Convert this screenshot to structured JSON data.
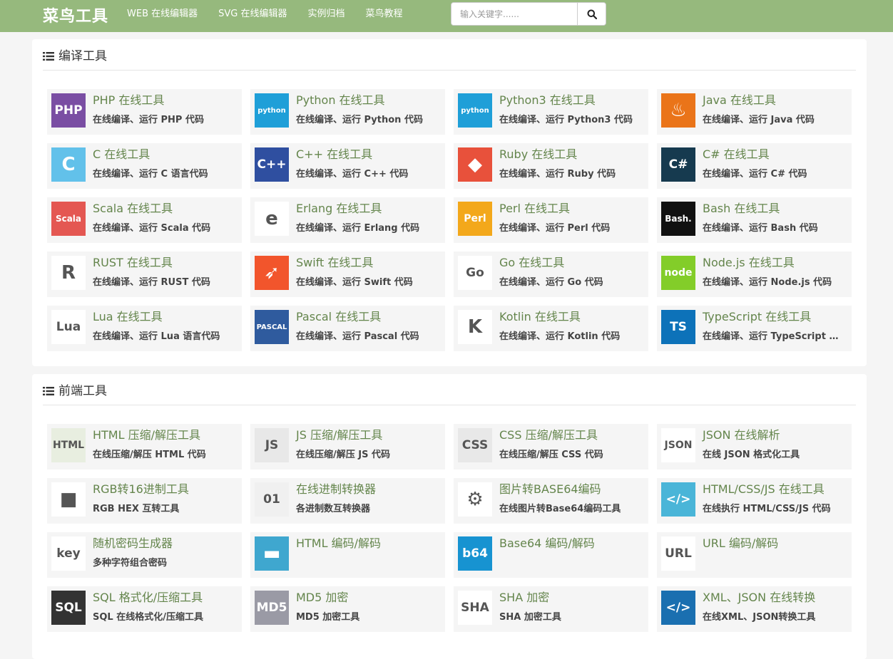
{
  "nav": {
    "brand": "菜鸟工具",
    "links": [
      "WEB 在线编辑器",
      "SVG 在线编辑器",
      "实例归档",
      "菜鸟教程"
    ],
    "search_placeholder": "输入关键字......"
  },
  "sections": [
    {
      "title": "编译工具",
      "items": [
        {
          "title": "PHP 在线工具",
          "desc": "在线编译、运行 PHP 代码",
          "icon": "php-icon",
          "bg": "#7a4ea3",
          "label": "PHP"
        },
        {
          "title": "Python 在线工具",
          "desc": "在线编译、运行 Python 代码",
          "icon": "python-icon",
          "bg": "#1f9fd8",
          "label": "python"
        },
        {
          "title": "Python3 在线工具",
          "desc": "在线编译、运行 Python3 代码",
          "icon": "python3-icon",
          "bg": "#1f9fd8",
          "label": "python"
        },
        {
          "title": "Java 在线工具",
          "desc": "在线编译、运行 Java 代码",
          "icon": "java-icon",
          "bg": "#ea7419",
          "label": "♨"
        },
        {
          "title": "C 在线工具",
          "desc": "在线编译、运行 C 语言代码",
          "icon": "c-icon",
          "bg": "#62c1ea",
          "label": "C"
        },
        {
          "title": "C++ 在线工具",
          "desc": "在线编译、运行 C++ 代码",
          "icon": "cpp-icon",
          "bg": "#2f4fa0",
          "label": "C++"
        },
        {
          "title": "Ruby 在线工具",
          "desc": "在线编译、运行 Ruby 代码",
          "icon": "ruby-icon",
          "bg": "#e8513b",
          "label": "◆"
        },
        {
          "title": "C# 在线工具",
          "desc": "在线编译、运行 C# 代码",
          "icon": "csharp-icon",
          "bg": "#163a4f",
          "label": "C#"
        },
        {
          "title": "Scala 在线工具",
          "desc": "在线编译、运行 Scala 代码",
          "icon": "scala-icon",
          "bg": "#e45752",
          "label": "Scala"
        },
        {
          "title": "Erlang 在线工具",
          "desc": "在线编译、运行 Erlang 代码",
          "icon": "erlang-icon",
          "bg": "#ffffff",
          "label": "e"
        },
        {
          "title": "Perl 在线工具",
          "desc": "在线编译、运行 Perl 代码",
          "icon": "perl-icon",
          "bg": "#f3a81b",
          "label": "Perl"
        },
        {
          "title": "Bash 在线工具",
          "desc": "在线编译、运行 Bash 代码",
          "icon": "bash-icon",
          "bg": "#111111",
          "label": "Bash."
        },
        {
          "title": "RUST 在线工具",
          "desc": "在线编译、运行 RUST 代码",
          "icon": "rust-icon",
          "bg": "#ffffff",
          "label": "R"
        },
        {
          "title": "Swift 在线工具",
          "desc": "在线编译、运行 Swift 代码",
          "icon": "swift-icon",
          "bg": "#f2552c",
          "label": "➶"
        },
        {
          "title": "Go 在线工具",
          "desc": "在线编译、运行 Go 代码",
          "icon": "go-gopher-icon",
          "bg": "#ffffff",
          "label": "Go"
        },
        {
          "title": "Node.js 在线工具",
          "desc": "在线编译、运行 Node.js 代码",
          "icon": "nodejs-icon",
          "bg": "#83cd29",
          "label": "node"
        },
        {
          "title": "Lua 在线工具",
          "desc": "在线编译、运行 Lua 语言代码",
          "icon": "lua-icon",
          "bg": "#ffffff",
          "label": "Lua"
        },
        {
          "title": "Pascal 在线工具",
          "desc": "在线编译、运行 Pascal 代码",
          "icon": "pascal-icon",
          "bg": "#2f5b9e",
          "label": "PASCAL"
        },
        {
          "title": "Kotlin 在线工具",
          "desc": "在线编译、运行 Kotlin 代码",
          "icon": "kotlin-icon",
          "bg": "#ffffff",
          "label": "K"
        },
        {
          "title": "TypeScript 在线工具",
          "desc": "在线编译、运行 TypeScript 代码",
          "icon": "typescript-icon",
          "bg": "#0d72b9",
          "label": "TS"
        }
      ]
    },
    {
      "title": "前端工具",
      "items": [
        {
          "title": "HTML 压缩/解压工具",
          "desc": "在线压缩/解压 HTML 代码",
          "icon": "html-compress-icon",
          "bg": "#e8eee0",
          "label": "HTML"
        },
        {
          "title": "JS 压缩/解压工具",
          "desc": "在线压缩/解压 JS 代码",
          "icon": "js-compress-icon",
          "bg": "#e8e8e8",
          "label": "JS"
        },
        {
          "title": "CSS 压缩/解压工具",
          "desc": "在线压缩/解压 CSS 代码",
          "icon": "css-compress-icon",
          "bg": "#e8e8e8",
          "label": "CSS"
        },
        {
          "title": "JSON 在线解析",
          "desc": "在线 JSON 格式化工具",
          "icon": "json-gear-icon",
          "bg": "#ffffff",
          "label": "JSON"
        },
        {
          "title": "RGB转16进制工具",
          "desc": "RGB HEX 互转工具",
          "icon": "rgb-cubes-icon",
          "bg": "#ffffff",
          "label": "■"
        },
        {
          "title": "在线进制转换器",
          "desc": "各进制数互转换器",
          "icon": "binary-converter-icon",
          "bg": "#f0f0f0",
          "label": "01"
        },
        {
          "title": "图片转BASE64编码",
          "desc": "在线图片转Base64编码工具",
          "icon": "base64-gears-icon",
          "bg": "#ffffff",
          "label": "⚙"
        },
        {
          "title": "HTML/CSS/JS 在线工具",
          "desc": "在线执行 HTML/CSS/JS 代码",
          "icon": "code-window-icon",
          "bg": "#4ab5d8",
          "label": "</>"
        },
        {
          "title": "随机密码生成器",
          "desc": "多种字符组合密码",
          "icon": "key-icon",
          "bg": "#ffffff",
          "label": "key"
        },
        {
          "title": "HTML 编码/解码",
          "desc": "",
          "icon": "monitor-icon",
          "bg": "#3fa7cf",
          "label": "▬"
        },
        {
          "title": "Base64 编码/解码",
          "desc": "",
          "icon": "b64-icon",
          "bg": "#1793d1",
          "label": "b64"
        },
        {
          "title": "URL 编码/解码",
          "desc": "",
          "icon": "url-document-icon",
          "bg": "#ffffff",
          "label": "URL"
        },
        {
          "title": "SQL 格式化/压缩工具",
          "desc": "SQL 在线格式化/压缩工具",
          "icon": "sql-database-icon",
          "bg": "#333333",
          "label": "SQL"
        },
        {
          "title": "MD5 加密",
          "desc": "MD5 加密工具",
          "icon": "md5-icon",
          "bg": "#9a9aa5",
          "label": "MD5"
        },
        {
          "title": "SHA 加密",
          "desc": "SHA 加密工具",
          "icon": "sha-database-key-icon",
          "bg": "#ffffff",
          "label": "SHA"
        },
        {
          "title": "XML、JSON 在线转换",
          "desc": "在线XML、JSON转换工具",
          "icon": "xml-json-icon",
          "bg": "#1a6fb0",
          "label": "</>"
        }
      ]
    }
  ]
}
